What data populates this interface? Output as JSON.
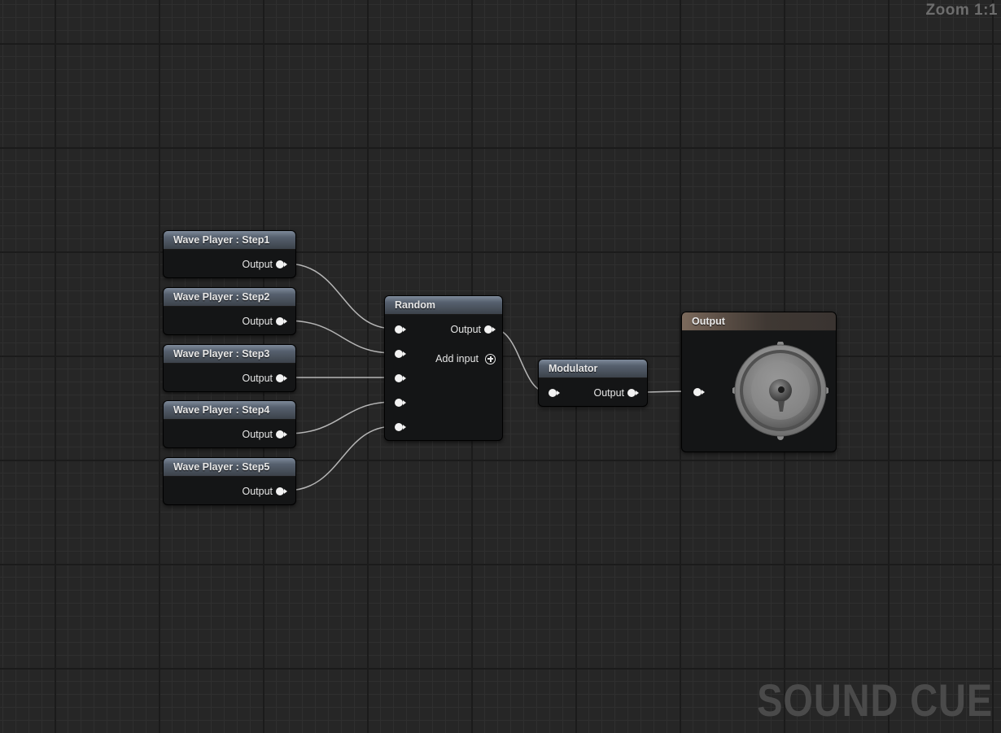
{
  "view": {
    "zoom_label": "Zoom 1:1",
    "watermark": "SOUND CUE"
  },
  "wave_players": [
    {
      "title": "Wave Player : Step1",
      "output_label": "Output"
    },
    {
      "title": "Wave Player : Step2",
      "output_label": "Output"
    },
    {
      "title": "Wave Player : Step3",
      "output_label": "Output"
    },
    {
      "title": "Wave Player : Step4",
      "output_label": "Output"
    },
    {
      "title": "Wave Player : Step5",
      "output_label": "Output"
    }
  ],
  "random_node": {
    "title": "Random",
    "output_label": "Output",
    "add_input_label": "Add input",
    "input_count": 5
  },
  "modulator_node": {
    "title": "Modulator",
    "output_label": "Output"
  },
  "output_node": {
    "title": "Output",
    "icon": "speaker-icon"
  },
  "colors": {
    "background": "#262626",
    "node_body": "#141516",
    "wire": "#cfcfcf",
    "pin": "#f2f2f2"
  }
}
